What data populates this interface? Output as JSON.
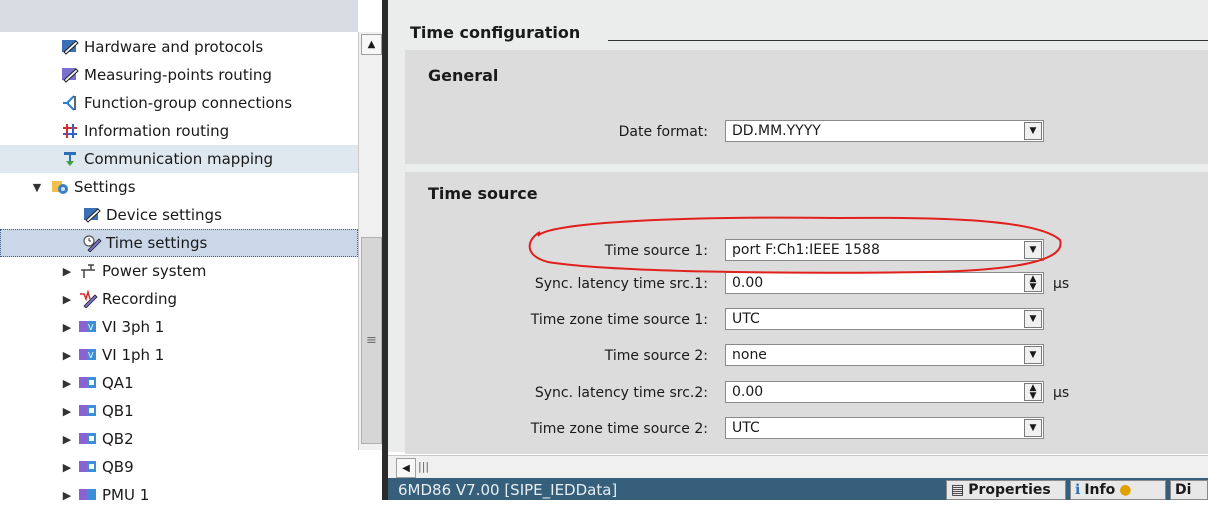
{
  "tree": {
    "items": [
      {
        "label": "Hardware and protocols",
        "icon": "pen-icon"
      },
      {
        "label": "Measuring-points routing",
        "icon": "pen-icon"
      },
      {
        "label": "Function-group connections",
        "icon": "connection-icon"
      },
      {
        "label": "Information routing",
        "icon": "routing-grid-icon"
      },
      {
        "label": "Communication mapping",
        "icon": "mapping-icon"
      },
      {
        "label": "Settings",
        "icon": "settings-folder-icon"
      },
      {
        "label": "Device settings",
        "icon": "pen-icon"
      },
      {
        "label": "Time settings",
        "icon": "clock-pen-icon"
      },
      {
        "label": "Power system",
        "icon": "power-system-icon"
      },
      {
        "label": "Recording",
        "icon": "recording-icon"
      },
      {
        "label": "VI 3ph 1",
        "icon": "function-group-icon"
      },
      {
        "label": "VI 1ph 1",
        "icon": "function-group-icon"
      },
      {
        "label": "QA1",
        "icon": "function-group-icon"
      },
      {
        "label": "QB1",
        "icon": "function-group-icon"
      },
      {
        "label": "QB2",
        "icon": "function-group-icon"
      },
      {
        "label": "QB9",
        "icon": "function-group-icon"
      },
      {
        "label": "PMU 1",
        "icon": "function-group-icon"
      }
    ]
  },
  "main": {
    "title": "Time configuration",
    "general": {
      "title": "General",
      "date_format_label": "Date format:",
      "date_format_value": "DD.MM.YYYY"
    },
    "time_source": {
      "title": "Time source",
      "rows": [
        {
          "label": "Time source 1:",
          "value": "port F:Ch1:IEEE 1588",
          "unit": ""
        },
        {
          "label": "Sync. latency time src.1:",
          "value": "0.00",
          "unit": "µs"
        },
        {
          "label": "Time zone time source 1:",
          "value": "UTC",
          "unit": ""
        },
        {
          "label": "Time source 2:",
          "value": "none",
          "unit": ""
        },
        {
          "label": "Sync. latency time src.2:",
          "value": "0.00",
          "unit": "µs"
        },
        {
          "label": "Time zone time source 2:",
          "value": "UTC",
          "unit": ""
        }
      ]
    }
  },
  "bottom": {
    "editor_title": "6MD86 V7.00 [SIPE_IEDData]",
    "tabs": [
      "Properties",
      "Info",
      "Di"
    ]
  },
  "colors": {
    "highlight_circle": "#e0201c",
    "selected_row": "#c9d7e8",
    "status_bar": "#355f7a"
  }
}
